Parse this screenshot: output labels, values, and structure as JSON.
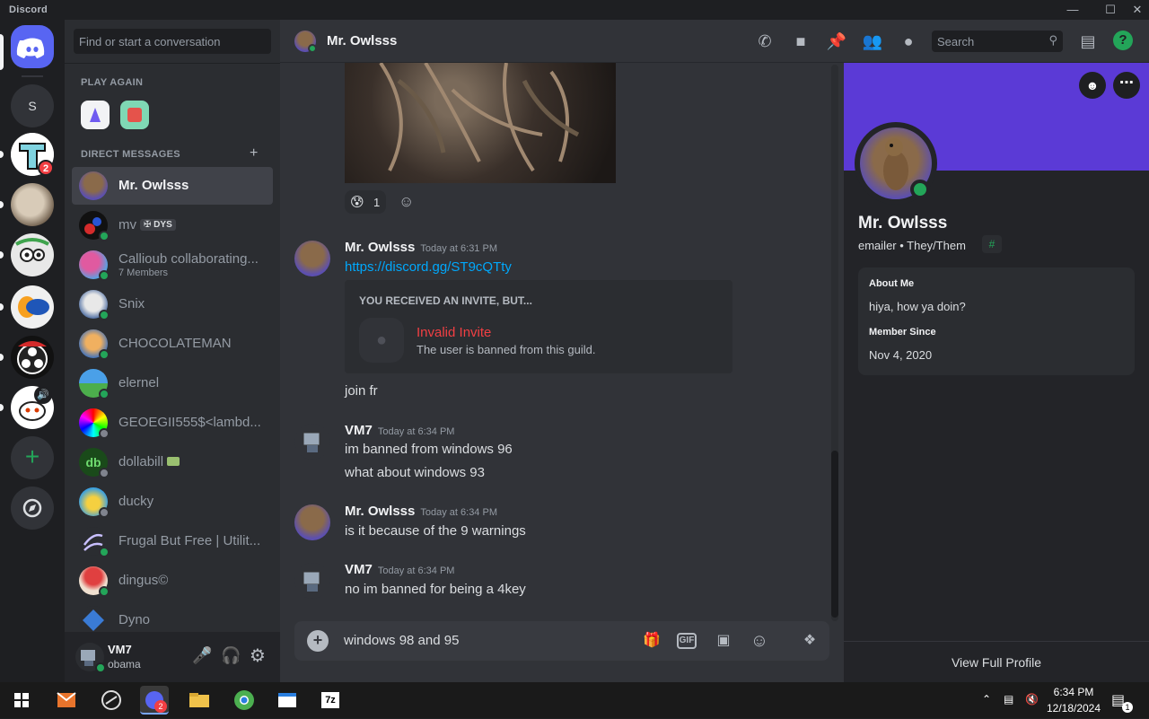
{
  "window": {
    "title": "Discord"
  },
  "servers": {
    "home_label": "Discord",
    "s_label": "S",
    "badge_count": "2"
  },
  "dm_sidebar": {
    "search_placeholder": "Find or start a conversation",
    "play_again": "PLAY AGAIN",
    "direct_messages": "DIRECT MESSAGES",
    "items": [
      {
        "name": "Mr. Owlsss",
        "sub": "",
        "status": "online",
        "active": true
      },
      {
        "name": "mv",
        "tag": "DYS",
        "sub": "",
        "status": "online"
      },
      {
        "name": "Callioub collaborating...",
        "sub": "7 Members",
        "status": "online"
      },
      {
        "name": "Snix",
        "sub": "",
        "status": "online"
      },
      {
        "name": "CHOCOLATEMAN",
        "sub": "",
        "status": "online"
      },
      {
        "name": "elernel",
        "sub": "",
        "status": "online"
      },
      {
        "name": "GEOEGII555$<lambd...",
        "sub": "",
        "status": "offline"
      },
      {
        "name": "dollabill",
        "sub": "",
        "status": "offline"
      },
      {
        "name": "ducky",
        "sub": "",
        "status": "offline"
      },
      {
        "name": "Frugal But Free | Utilit...",
        "sub": "",
        "status": "online"
      },
      {
        "name": "dingus©",
        "sub": "",
        "status": "online"
      },
      {
        "name": "Dyno",
        "sub": "",
        "status": "online"
      }
    ]
  },
  "user_panel": {
    "name": "VM7",
    "status_text": "obama"
  },
  "chat": {
    "header_name": "Mr. Owlsss",
    "search_placeholder": "Search",
    "reaction_count": "1",
    "messages": [
      {
        "author": "Mr. Owlsss",
        "time": "Today at 6:31 PM",
        "link": "https://discord.gg/ST9cQTty"
      },
      {
        "author": "VM7",
        "time": "Today at 6:34 PM",
        "lines": [
          "im banned from windows 96",
          "what about windows 93"
        ]
      },
      {
        "author": "Mr. Owlsss",
        "time": "Today at 6:34 PM",
        "lines": [
          "is it because of the 9 warnings"
        ]
      },
      {
        "author": "VM7",
        "time": "Today at 6:34 PM",
        "lines": [
          "no im banned for being a 4key"
        ]
      }
    ],
    "invite": {
      "heading": "YOU RECEIVED AN INVITE, BUT...",
      "title": "Invalid Invite",
      "desc": "The user is banned from this guild."
    },
    "join_line": "join fr",
    "composer_text": "windows 98 and 95",
    "gif_label": "GIF"
  },
  "profile": {
    "name": "Mr. Owlsss",
    "username": "emailer",
    "pronouns": "They/Them",
    "about_label": "About Me",
    "about_text": "hiya, how ya doin?",
    "member_since_label": "Member Since",
    "member_since": "Nov 4, 2020",
    "view_full": "View Full Profile"
  },
  "taskbar": {
    "time": "6:34 PM",
    "date": "12/18/2024",
    "notif_count": "1",
    "discord_badge": "2",
    "zip_label": "7z"
  },
  "colors": {
    "blurple": "#5865f2",
    "online": "#23a559",
    "danger": "#f23f43",
    "link": "#00a8fc",
    "banner": "#5b3ad6"
  }
}
